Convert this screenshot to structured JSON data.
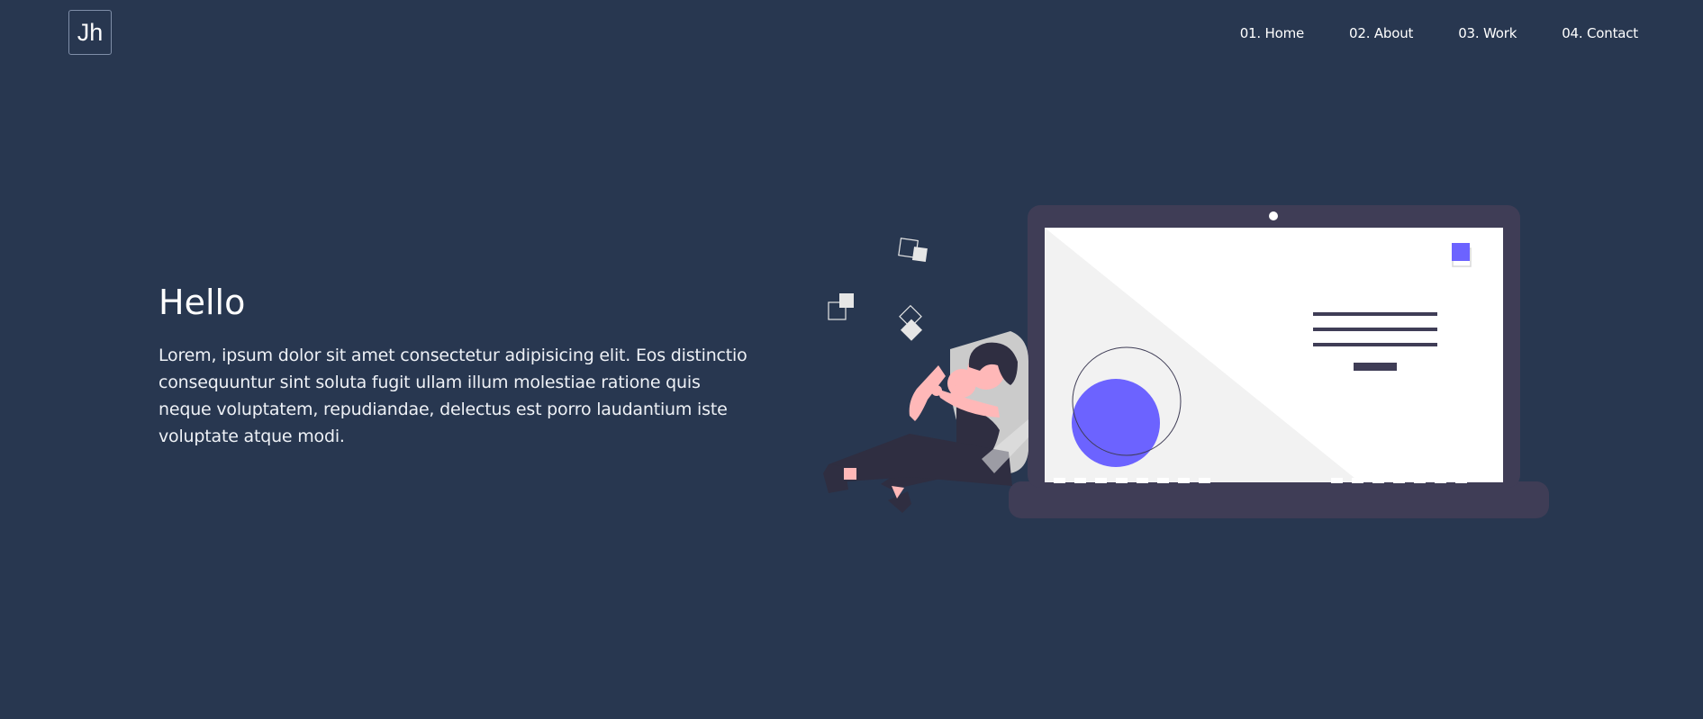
{
  "header": {
    "logo_text": "Jh",
    "nav": [
      {
        "label": "01. Home"
      },
      {
        "label": "02. About"
      },
      {
        "label": "03. Work"
      },
      {
        "label": "04. Contact"
      }
    ]
  },
  "hero": {
    "title": "Hello",
    "paragraph": "Lorem, ipsum dolor sit amet consectetur adipisicing elit. Eos distinctio consequuntur sint soluta fugit ullam illum molestiae ratione quis neque voluptatem, repudiandae, delectus est porro laudantium iste voluptate atque modi."
  },
  "colors": {
    "background": "#283750",
    "laptop_frame": "#3f3d56",
    "accent": "#6c63ff",
    "skin": "#ffb8b8"
  }
}
